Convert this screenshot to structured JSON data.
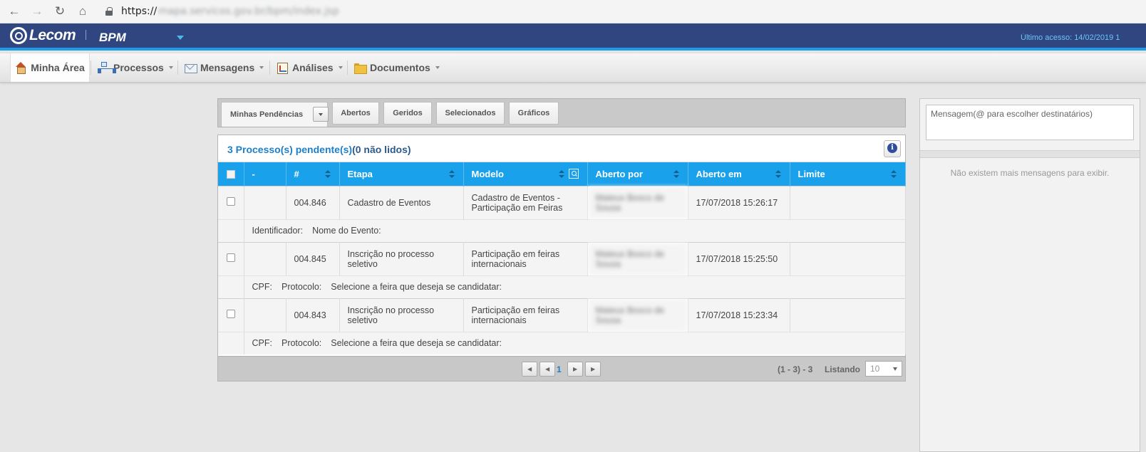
{
  "browser": {
    "url_scheme": "https://",
    "url_rest": "mapa.servicos.gov.br/bpm/index.jsp"
  },
  "header": {
    "logo_text": "Lecom",
    "app_title": "BPM",
    "last_access": "Último acesso: 14/02/2019 1"
  },
  "menu": {
    "items": [
      {
        "label": "Minha Área",
        "icon": "home-icon"
      },
      {
        "label": "Processos",
        "icon": "process-icon"
      },
      {
        "label": "Mensagens",
        "icon": "mail-icon"
      },
      {
        "label": "Análises",
        "icon": "chart-icon"
      },
      {
        "label": "Documentos",
        "icon": "folder-icon"
      }
    ]
  },
  "tabs": [
    {
      "label": "Minhas Pendências",
      "active": true
    },
    {
      "label": "Abertos"
    },
    {
      "label": "Geridos"
    },
    {
      "label": "Selecionados"
    },
    {
      "label": "Gráficos"
    }
  ],
  "grid": {
    "title_count": "3 Processo(s) pendente(s)",
    "title_unread": "(0 não lidos)",
    "columns": [
      "-",
      "#",
      "Etapa",
      "Modelo",
      "Aberto por",
      "Aberto em",
      "Limite"
    ],
    "rows": [
      {
        "num": "004.846",
        "etapa": "Cadastro de Eventos",
        "modelo": "Cadastro de Eventos - Participação em Feiras",
        "aberto_por": "Mateus Bosco de Sousa",
        "aberto_em": "17/07/2018 15:26:17",
        "limite": "",
        "details": [
          "Identificador:",
          "Nome do Evento:"
        ]
      },
      {
        "num": "004.845",
        "etapa": "Inscrição no processo seletivo",
        "modelo": "Participação em feiras internacionais",
        "aberto_por": "Mateus Bosco de Sousa",
        "aberto_em": "17/07/2018 15:25:50",
        "limite": "",
        "details": [
          "CPF:",
          "Protocolo:",
          "Selecione a feira que deseja se candidatar:"
        ]
      },
      {
        "num": "004.843",
        "etapa": "Inscrição no processo seletivo",
        "modelo": "Participação em feiras internacionais",
        "aberto_por": "Mateus Bosco de Sousa",
        "aberto_em": "17/07/2018 15:23:34",
        "limite": "",
        "details": [
          "CPF:",
          "Protocolo:",
          "Selecione a feira que deseja se candidatar:"
        ]
      }
    ]
  },
  "pager": {
    "current_page": "1",
    "range": "(1 - 3) - 3",
    "listing_label": "Listando",
    "page_size": "10"
  },
  "messages": {
    "input_placeholder": "Mensagem(@ para escolher destinatários)",
    "empty_text": "Não existem mais mensagens para exibir."
  },
  "colors": {
    "header_bg": "#2f4681",
    "accent_blue": "#1aa1eb",
    "title_blue": "#1e7fc9"
  }
}
